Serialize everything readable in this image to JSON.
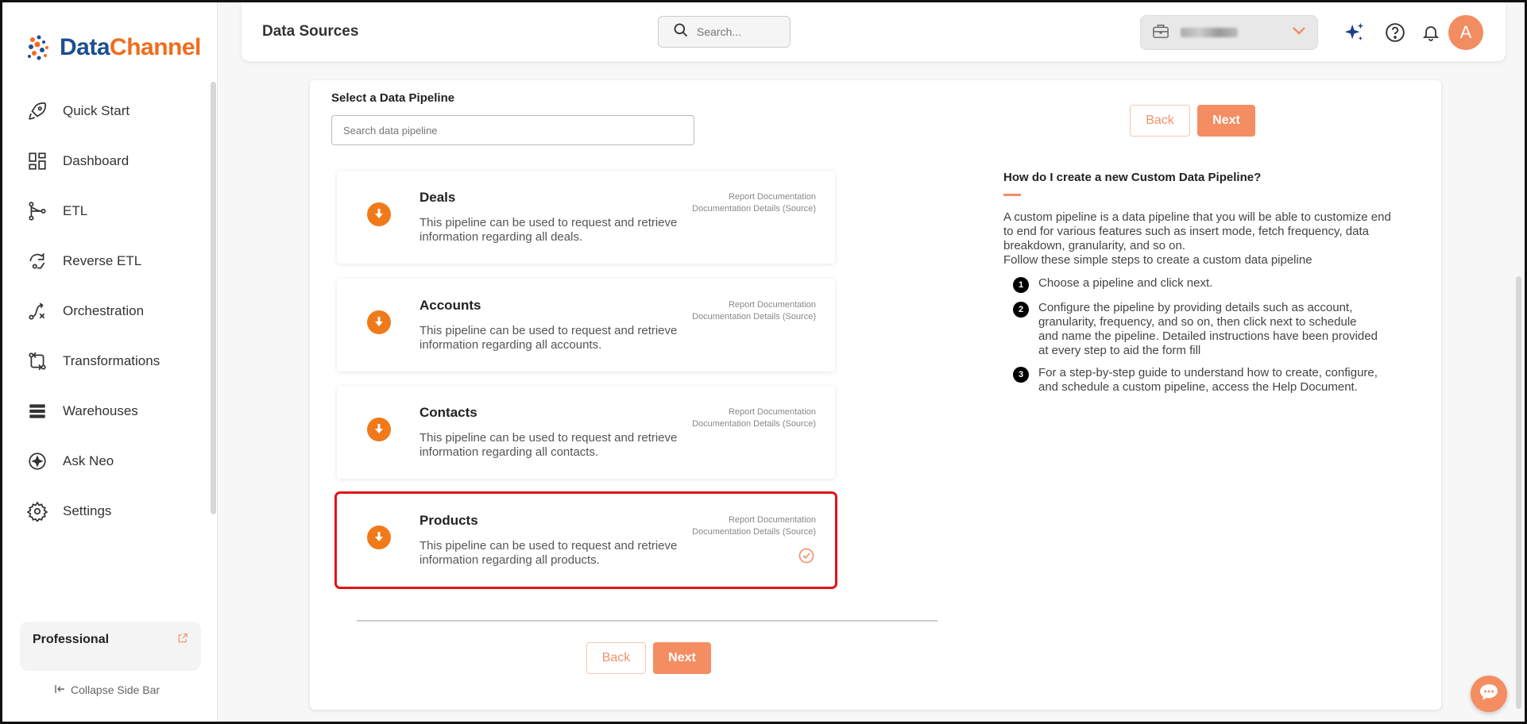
{
  "brand": {
    "logo_part1": "Data",
    "logo_part2": "Channel"
  },
  "sidebar": {
    "items": [
      {
        "label": "Quick Start",
        "icon": "rocket-icon"
      },
      {
        "label": "Dashboard",
        "icon": "dashboard-icon"
      },
      {
        "label": "ETL",
        "icon": "etl-icon"
      },
      {
        "label": "Reverse ETL",
        "icon": "reverse-etl-icon"
      },
      {
        "label": "Orchestration",
        "icon": "orchestration-icon"
      },
      {
        "label": "Transformations",
        "icon": "transformations-icon"
      },
      {
        "label": "Warehouses",
        "icon": "warehouses-icon"
      },
      {
        "label": "Ask Neo",
        "icon": "ask-neo-icon"
      },
      {
        "label": "Settings",
        "icon": "settings-icon"
      }
    ],
    "plan": "Professional",
    "collapse_label": "Collapse Side Bar"
  },
  "header": {
    "title": "Data Sources",
    "search_placeholder": "Search..."
  },
  "main": {
    "select_label": "Select a Data Pipeline",
    "search_placeholder": "Search data pipeline",
    "back_label": "Back",
    "next_label": "Next",
    "pipelines": [
      {
        "title": "Deals",
        "desc": "This pipeline can be used to request and retrieve information regarding all deals.",
        "link1": "Report Documentation",
        "link2": "Documentation Details (Source)"
      },
      {
        "title": "Accounts",
        "desc": "This pipeline can be used to request and retrieve information regarding all accounts.",
        "link1": "Report Documentation",
        "link2": "Documentation Details (Source)"
      },
      {
        "title": "Contacts",
        "desc": "This pipeline can be used to request and retrieve information regarding all contacts.",
        "link1": "Report Documentation",
        "link2": "Documentation Details (Source)"
      },
      {
        "title": "Products",
        "desc": "This pipeline can be used to request and retrieve information regarding all products.",
        "link1": "Report Documentation",
        "link2": "Documentation Details (Source)",
        "selected": true
      }
    ]
  },
  "help": {
    "title": "How do I create a new Custom Data Pipeline?",
    "intro": "A custom pipeline is a data pipeline that you will be able to customize end to end for various features such as insert mode, fetch frequency, data breakdown, granularity, and so on.",
    "intro2": "Follow these simple steps to create a custom data pipeline",
    "steps": [
      {
        "num": "1",
        "text": "Choose a pipeline and click next."
      },
      {
        "num": "2",
        "text": "Configure the pipeline by providing details such as account, granularity, frequency, and so on, then click next to schedule and name the pipeline. Detailed instructions have been provided at every step to aid the form fill"
      },
      {
        "num": "3",
        "text": "For a step-by-step guide to understand how to create, configure, and schedule a custom pipeline, access the Help Document."
      }
    ]
  },
  "colors": {
    "accent": "#f58d62",
    "brand_blue": "#1d4f91",
    "brand_orange": "#f26b1d",
    "selected_border": "#e0141a"
  }
}
